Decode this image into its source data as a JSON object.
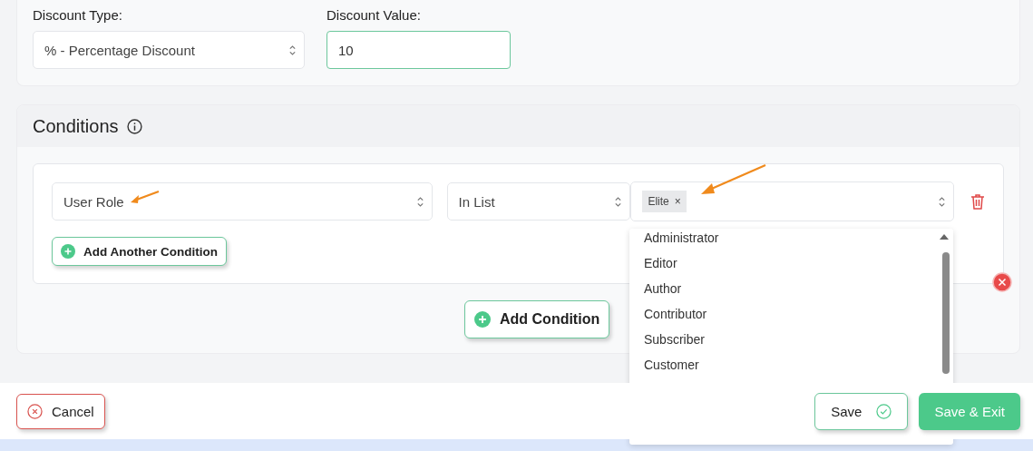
{
  "discount": {
    "type_label": "Discount Type:",
    "type_value": "% - Percentage Discount",
    "value_label": "Discount Value:",
    "value": "10"
  },
  "conditions": {
    "title": "Conditions",
    "rows": [
      {
        "field": "User Role",
        "operator": "In List",
        "tags": [
          {
            "label": "Elite",
            "remove": "×"
          }
        ]
      }
    ],
    "add_another": "Add Another Condition",
    "add": "Add Condition"
  },
  "dropdown": {
    "options": [
      "Administrator",
      "Editor",
      "Author",
      "Contributor",
      "Subscriber",
      "Customer"
    ]
  },
  "footer": {
    "cancel": "Cancel",
    "save": "Save",
    "save_exit": "Save & Exit"
  }
}
